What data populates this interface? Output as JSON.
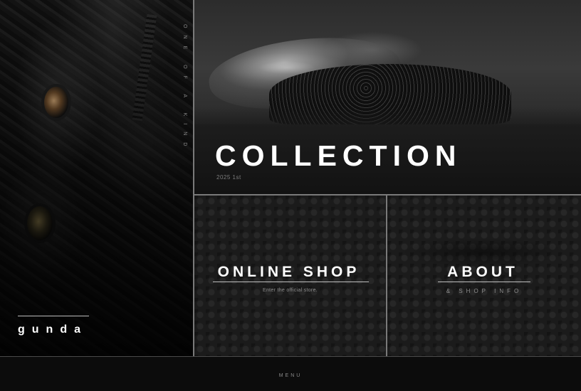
{
  "sidebar": {
    "vertical_text": "ONE OF A KIND",
    "brand": "gunda"
  },
  "collection": {
    "title": "COLLECTION",
    "subtitle": "2025 1st"
  },
  "online_shop": {
    "title": "ONLINE SHOP",
    "subtitle": "Enter the official store."
  },
  "about": {
    "title": "ABOUT",
    "subtitle": "& SHOP INFO"
  },
  "footer": {
    "menu_label": "MENU"
  }
}
